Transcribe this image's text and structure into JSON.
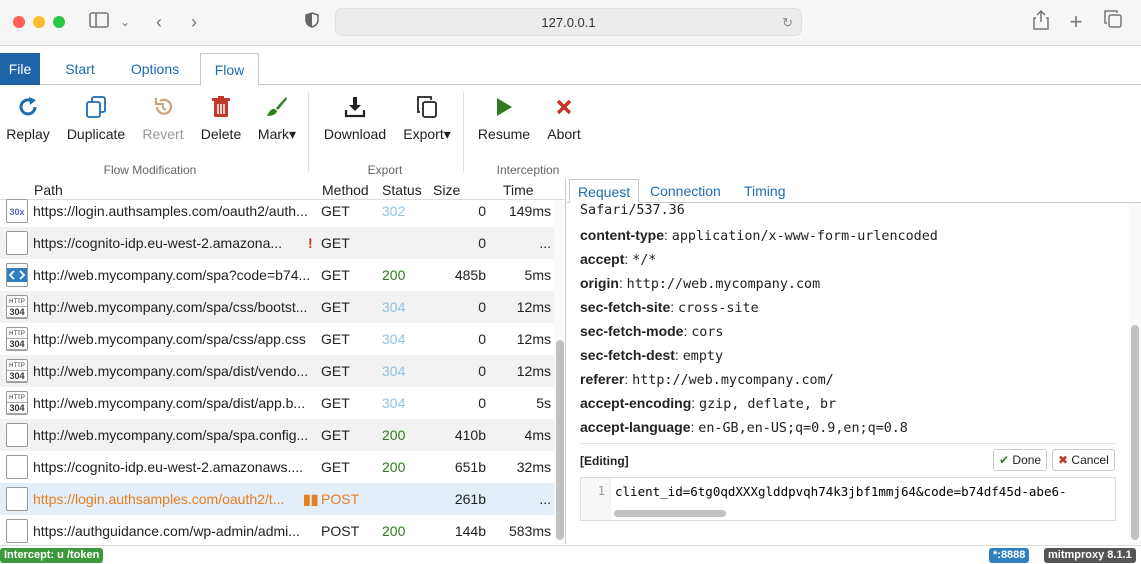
{
  "browser": {
    "url": "127.0.0.1",
    "colors": {
      "close": "#ff5f57",
      "minimize": "#febc2e",
      "maximize": "#28c840"
    }
  },
  "menu": {
    "file": "File",
    "tabs": [
      "Start",
      "Options",
      "Flow"
    ],
    "active_tab": "Flow"
  },
  "ribbon": {
    "replay": "Replay",
    "duplicate": "Duplicate",
    "revert": "Revert",
    "delete": "Delete",
    "mark": "Mark▾",
    "download": "Download",
    "export": "Export▾",
    "resume": "Resume",
    "abort": "Abort",
    "group_flow": "Flow Modification",
    "group_export": "Export",
    "group_interception": "Interception"
  },
  "flowlist": {
    "headers": {
      "path": "Path",
      "method": "Method",
      "status": "Status",
      "size": "Size",
      "time": "Time"
    },
    "rows": [
      {
        "icon": "30x",
        "path": "https://login.authsamples.com/oauth2/auth...",
        "method": "GET",
        "status": "302",
        "size": "0",
        "time": "149ms",
        "status_color": "#8ec3e6"
      },
      {
        "icon": "",
        "path": "https://cognito-idp.eu-west-2.amazona...",
        "flag": "!",
        "method": "GET",
        "status": "",
        "size": "0",
        "time": "...",
        "status_color": "#222"
      },
      {
        "icon": "<>",
        "path": "http://web.mycompany.com/spa?code=b74...",
        "method": "GET",
        "status": "200",
        "size": "485b",
        "time": "5ms",
        "status_color": "#2f7d1f"
      },
      {
        "icon": "HTTP 304",
        "path": "http://web.mycompany.com/spa/css/bootst...",
        "method": "GET",
        "status": "304",
        "size": "0",
        "time": "12ms",
        "status_color": "#8ec3e6"
      },
      {
        "icon": "HTTP 304",
        "path": "http://web.mycompany.com/spa/css/app.css",
        "method": "GET",
        "status": "304",
        "size": "0",
        "time": "12ms",
        "status_color": "#8ec3e6"
      },
      {
        "icon": "HTTP 304",
        "path": "http://web.mycompany.com/spa/dist/vendo...",
        "method": "GET",
        "status": "304",
        "size": "0",
        "time": "12ms",
        "status_color": "#8ec3e6"
      },
      {
        "icon": "HTTP 304",
        "path": "http://web.mycompany.com/spa/dist/app.b...",
        "method": "GET",
        "status": "304",
        "size": "0",
        "time": "5s",
        "status_color": "#8ec3e6"
      },
      {
        "icon": "",
        "path": "http://web.mycompany.com/spa/spa.config...",
        "method": "GET",
        "status": "200",
        "size": "410b",
        "time": "4ms",
        "status_color": "#2f7d1f"
      },
      {
        "icon": "",
        "path": "https://cognito-idp.eu-west-2.amazonaws....",
        "method": "GET",
        "status": "200",
        "size": "651b",
        "time": "32ms",
        "status_color": "#2f7d1f"
      },
      {
        "icon": "",
        "path": "https://login.authsamples.com/oauth2/t...",
        "flag": "▮▮",
        "method": "POST",
        "status": "",
        "size": "261b",
        "time": "...",
        "status_color": "#222",
        "intercepted": true
      },
      {
        "icon": "",
        "path": "https://authguidance.com/wp-admin/admi...",
        "method": "POST",
        "status": "200",
        "size": "144b",
        "time": "583ms",
        "status_color": "#2f7d1f"
      }
    ]
  },
  "detail": {
    "tabs": [
      "Request",
      "Connection",
      "Timing"
    ],
    "partial_line": "Safari/537.36",
    "headers": [
      {
        "name": "content-type",
        "value": "application/x-www-form-urlencoded"
      },
      {
        "name": "accept",
        "value": "*/*"
      },
      {
        "name": "origin",
        "value": "http://web.mycompany.com"
      },
      {
        "name": "sec-fetch-site",
        "value": "cross-site"
      },
      {
        "name": "sec-fetch-mode",
        "value": "cors"
      },
      {
        "name": "sec-fetch-dest",
        "value": "empty"
      },
      {
        "name": "referer",
        "value": "http://web.mycompany.com/"
      },
      {
        "name": "accept-encoding",
        "value": "gzip, deflate, br"
      },
      {
        "name": "accept-language",
        "value": "en-GB,en-US;q=0.9,en;q=0.8"
      }
    ],
    "editing_label": "[Editing]",
    "done": "Done",
    "cancel": "Cancel",
    "line_number": "1",
    "body": "client_id=6tg0qdXXXglddpvqh74k3jbf1mmj64&code=b74df45d-abe6-"
  },
  "footer": {
    "intercept": "Intercept: u /token",
    "port": "*:8888",
    "version": "mitmproxy 8.1.1"
  }
}
